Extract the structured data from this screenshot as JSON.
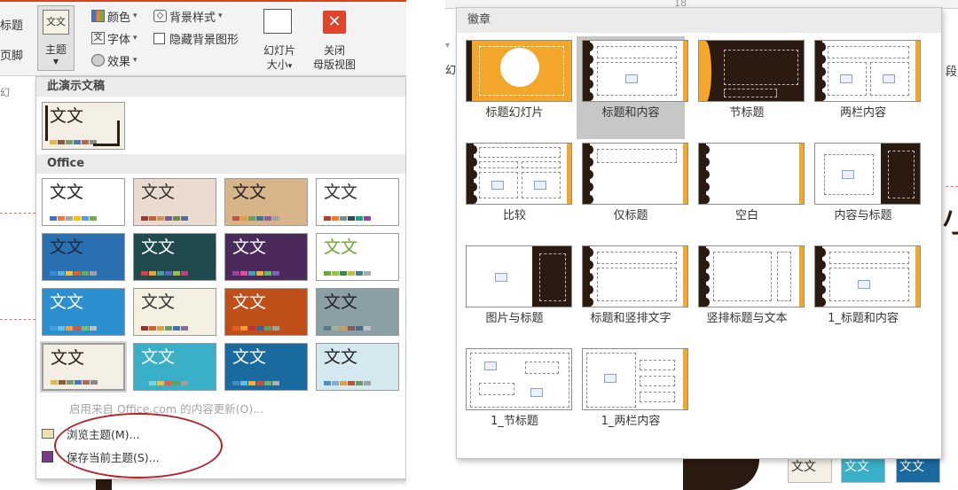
{
  "left": {
    "ribbon": {
      "edge_labels": [
        "标题",
        "页脚",
        "幻"
      ],
      "theme_button": {
        "icon_text": "文文",
        "label": "主题"
      },
      "colors_label": "颜色",
      "fonts_label": "字体",
      "effects_label": "效果",
      "bg_style_label": "背景样式",
      "hide_bg_label": "隐藏背景图形",
      "slide_size_label": [
        "幻灯片",
        "大小"
      ],
      "close_master_label": [
        "关闭",
        "母版视图"
      ]
    },
    "gallery": {
      "section_this": "此演示文稿",
      "section_office": "Office",
      "current_theme": {
        "text": "文文",
        "bg": "#f4efe4",
        "fg": "#2a1d12",
        "swatches": [
          "#e4b84a",
          "#8a5a3a",
          "#7a9a6a",
          "#4a7ab0",
          "#b06a5a",
          "#8a8a8a"
        ]
      },
      "office_themes": [
        {
          "text": "文文",
          "bg": "#ffffff",
          "fg": "#222",
          "swatches": [
            "#4472c4",
            "#ed7d31",
            "#a5a5a5",
            "#ffc000",
            "#5b9bd5",
            "#70ad47"
          ]
        },
        {
          "text": "文文",
          "bg": "#eadbd0",
          "fg": "#333",
          "swatches": [
            "#9b3b3b",
            "#c06040",
            "#d09050",
            "#7a5a8a",
            "#6a8a4a",
            "#5a6a9a"
          ]
        },
        {
          "text": "文文",
          "bg": "#d8b48a",
          "fg": "#222",
          "swatches": [
            "#c0504d",
            "#e0a040",
            "#70a060",
            "#4070a0",
            "#8060a0",
            "#a0a0a0"
          ]
        },
        {
          "text": "文文",
          "bg": "#ffffff",
          "fg": "#333",
          "swatches": [
            "#c0392b",
            "#e67e22",
            "#7f8c8d",
            "#34495e",
            "#16a085",
            "#8e44ad"
          ]
        },
        {
          "text": "文文",
          "bg": "#2a6fb0",
          "fg": "#1a2a3a",
          "swatches": [
            "#3a8ad0",
            "#5ab0e0",
            "#f0c030",
            "#e06030",
            "#60b060",
            "#a0a0a0"
          ]
        },
        {
          "text": "文文",
          "bg": "#1f4b4e",
          "fg": "#ffffff",
          "swatches": [
            "#e04040",
            "#f0a030",
            "#40a0a0",
            "#6060c0",
            "#a0c040",
            "#c04080"
          ]
        },
        {
          "text": "文文",
          "bg": "#4a2a5a",
          "fg": "#ffffff",
          "swatches": [
            "#a040a0",
            "#e05090",
            "#40a0c0",
            "#f0b030",
            "#60c060",
            "#8060c0"
          ]
        },
        {
          "text": "文文",
          "bg": "#ffffff",
          "fg": "#6aaa2a",
          "swatches": [
            "#6aaa2a",
            "#9ac040",
            "#3a8a4a",
            "#c0c040",
            "#4a7a9a",
            "#aaaaaa"
          ]
        },
        {
          "text": "文文",
          "bg": "#2b8fd0",
          "fg": "#ffffff",
          "swatches": [
            "#40a0e0",
            "#60c0f0",
            "#f0a040",
            "#e05040",
            "#70c070",
            "#c0c0c0"
          ]
        },
        {
          "text": "文文",
          "bg": "#f4f0e0",
          "fg": "#333",
          "swatches": [
            "#a03030",
            "#d06030",
            "#e0a040",
            "#60a060",
            "#4070b0",
            "#8a6a9a"
          ]
        },
        {
          "text": "文文",
          "bg": "#c0501a",
          "fg": "#ffffff",
          "swatches": [
            "#e06020",
            "#f0a030",
            "#c03030",
            "#4060a0",
            "#60a060",
            "#a0a0a0"
          ]
        },
        {
          "text": "文文",
          "bg": "#8aa0a6",
          "fg": "#222",
          "swatches": [
            "#5a7a80",
            "#a0b0a0",
            "#d0a050",
            "#8a5a5a",
            "#4a6a8a",
            "#c0c0c0"
          ]
        },
        {
          "text": "文文",
          "bg": "#f4efe4",
          "fg": "#2a1d12",
          "swatches": [
            "#e4b84a",
            "#8a5a3a",
            "#7a9a6a",
            "#4a7ab0",
            "#b06a5a",
            "#8a8a8a"
          ],
          "selected": true
        },
        {
          "text": "文文",
          "bg": "#3ab0c8",
          "fg": "#ffffff",
          "swatches": [
            "#40b0d0",
            "#80d0e0",
            "#f0c040",
            "#e06040",
            "#60a060",
            "#a0a0a0"
          ]
        },
        {
          "text": "文文",
          "bg": "#1a6aa0",
          "fg": "#ffffff",
          "swatches": [
            "#3a90c0",
            "#60c0e0",
            "#f0b040",
            "#d05030",
            "#70b070",
            "#b0b0b0"
          ]
        },
        {
          "text": "文文",
          "bg": "#d4e8f0",
          "fg": "#222",
          "swatches": [
            "#4a90c0",
            "#80b0d0",
            "#e0a040",
            "#c05040",
            "#60a060",
            "#a0a0a0"
          ]
        }
      ],
      "update_text": "启用来自 Office.com 的内容更新(O)...",
      "browse_label": "浏览主题(M)...",
      "save_label": "保存当前主题(S)..."
    }
  },
  "right": {
    "bg_font_size": "18",
    "bg_side_labels": [
      "段"
    ],
    "panel_title": "徽章",
    "layouts": [
      {
        "label": "标题幻灯片",
        "kind": "title"
      },
      {
        "label": "标题和内容",
        "kind": "content",
        "selected": true
      },
      {
        "label": "节标题",
        "kind": "section"
      },
      {
        "label": "两栏内容",
        "kind": "two"
      },
      {
        "label": "比较",
        "kind": "compare"
      },
      {
        "label": "仅标题",
        "kind": "titleonly"
      },
      {
        "label": "空白",
        "kind": "blank"
      },
      {
        "label": "内容与标题",
        "kind": "contentcap"
      },
      {
        "label": "图片与标题",
        "kind": "piccap"
      },
      {
        "label": "标题和竖排文字",
        "kind": "vert"
      },
      {
        "label": "竖排标题与文本",
        "kind": "verttitle"
      },
      {
        "label": "1_标题和内容",
        "kind": "content2"
      },
      {
        "label": "1_节标题",
        "kind": "section2"
      },
      {
        "label": "1_两栏内容",
        "kind": "two2"
      }
    ]
  }
}
